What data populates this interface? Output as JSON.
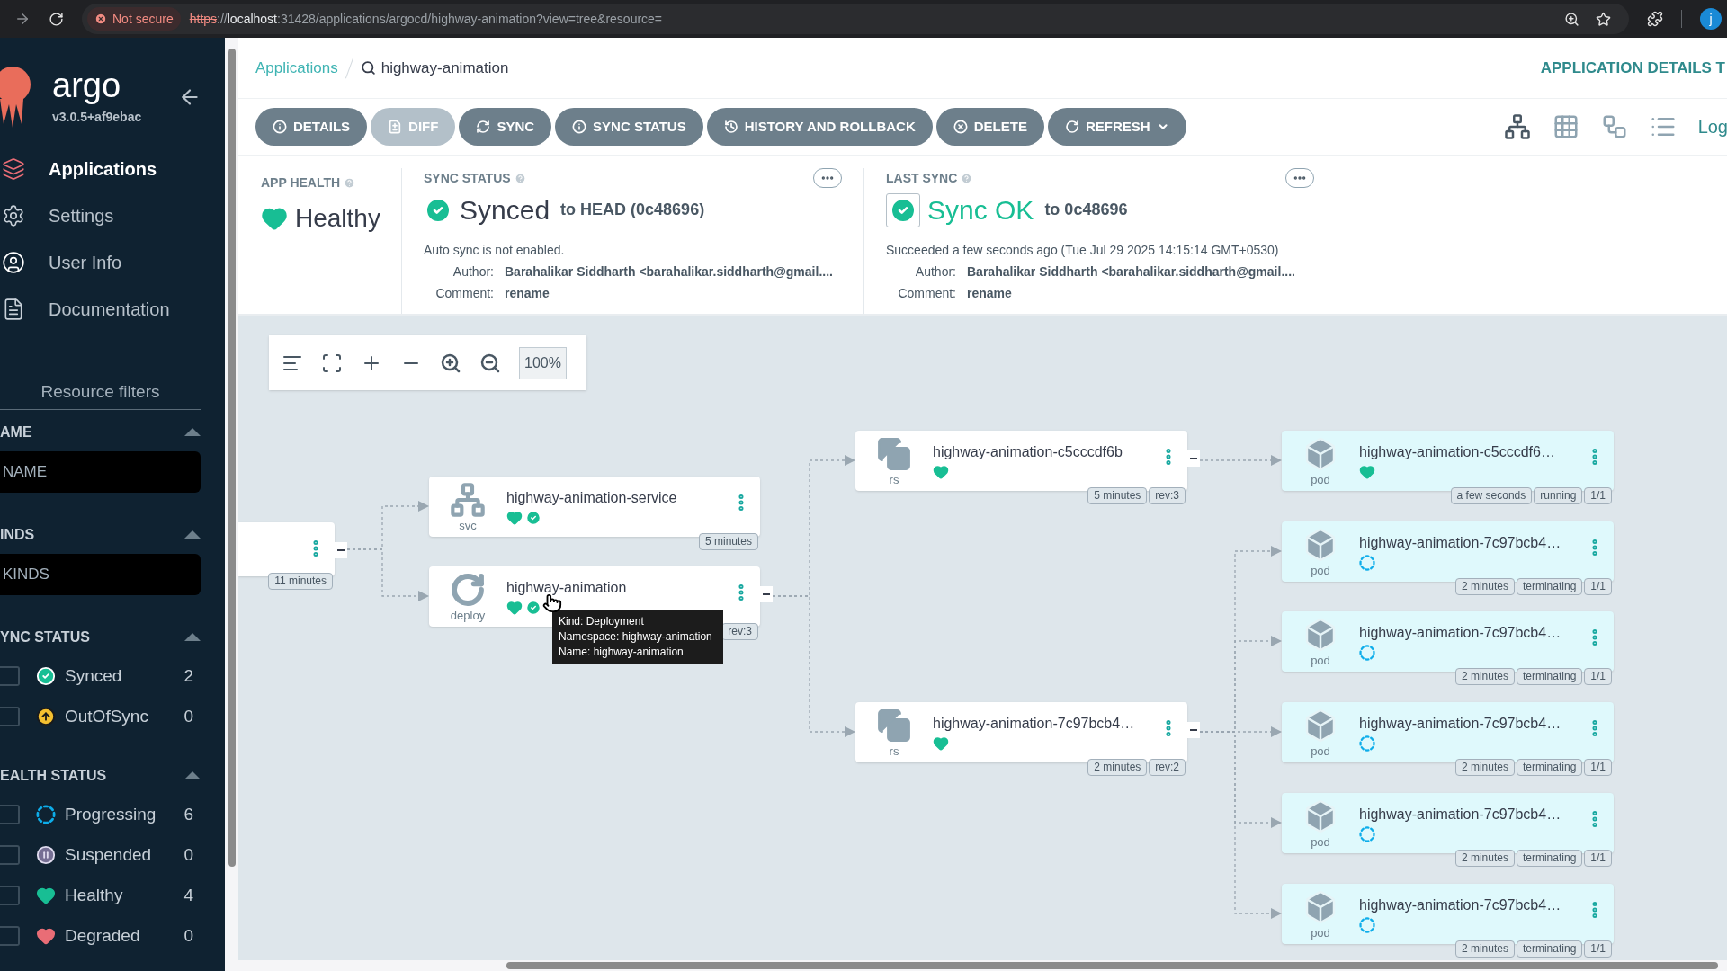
{
  "browser": {
    "security": "Not secure",
    "url_scheme": "https",
    "url_sep": "://",
    "url_host": "localhost",
    "url_path": ":31428/applications/argocd/highway-animation?view=tree&resource=",
    "avatar": "j"
  },
  "sidebar": {
    "logo": "argo",
    "version": "v3.0.5+af9ebac",
    "nav": [
      {
        "label": "Applications",
        "selected": true
      },
      {
        "label": "Settings",
        "selected": false
      },
      {
        "label": "User Info",
        "selected": false
      },
      {
        "label": "Documentation",
        "selected": false
      }
    ],
    "filters_title": "Resource filters",
    "filters": [
      {
        "title": "AME",
        "kind": "field",
        "placeholder": "NAME",
        "expanded": true
      },
      {
        "title": "INDS",
        "kind": "field",
        "placeholder": "KINDS",
        "expanded": true
      },
      {
        "title": "YNC STATUS",
        "kind": "checklist",
        "expanded": true,
        "items": [
          {
            "label": "Synced",
            "count": "2",
            "kind": "synced",
            "checked": false
          },
          {
            "label": "OutOfSync",
            "count": "0",
            "kind": "outofsync",
            "checked": false
          }
        ]
      },
      {
        "title": "EALTH STATUS",
        "kind": "checklist",
        "expanded": true,
        "items": [
          {
            "label": "Progressing",
            "count": "6",
            "kind": "progressing",
            "checked": false
          },
          {
            "label": "Suspended",
            "count": "0",
            "kind": "suspended",
            "checked": false
          },
          {
            "label": "Healthy",
            "count": "4",
            "kind": "healthy",
            "checked": false
          },
          {
            "label": "Degraded",
            "count": "0",
            "kind": "degraded",
            "checked": false
          }
        ]
      }
    ]
  },
  "header": {
    "breadcrumb": "Applications",
    "search_value": "highway-animation",
    "title": "APPLICATION DETAILS T"
  },
  "toolbar": [
    {
      "label": "DETAILS",
      "disabled": false,
      "dropdown": false
    },
    {
      "label": "DIFF",
      "disabled": true,
      "dropdown": false
    },
    {
      "label": "SYNC",
      "disabled": false,
      "dropdown": false
    },
    {
      "label": "SYNC STATUS",
      "disabled": false,
      "dropdown": false
    },
    {
      "label": "HISTORY AND ROLLBACK",
      "disabled": false,
      "dropdown": false
    },
    {
      "label": "DELETE",
      "disabled": false,
      "dropdown": false
    },
    {
      "label": "REFRESH",
      "disabled": false,
      "dropdown": true
    }
  ],
  "views": [
    {
      "kind": "tree",
      "selected": true
    },
    {
      "kind": "grid",
      "selected": false
    },
    {
      "kind": "network",
      "selected": false
    },
    {
      "kind": "list",
      "selected": false
    }
  ],
  "log_link": "Log",
  "app_health": {
    "label": "APP HEALTH",
    "status": "Healthy",
    "kind": "healthy"
  },
  "sync_status": {
    "label": "SYNC STATUS",
    "status": "Synced",
    "target": "to HEAD (0c48696)",
    "note": "Auto sync is not enabled.",
    "fields": [
      {
        "label": "Author:",
        "value": "Barahalikar Siddharth <barahalikar.siddharth@gmail...."
      },
      {
        "label": "Comment:",
        "value": "rename"
      }
    ]
  },
  "last_sync": {
    "label": "LAST SYNC",
    "status": "Sync OK",
    "target": "to 0c48696",
    "note": "Succeeded a few seconds ago (Tue Jul 29 2025 14:15:14 GMT+0530)",
    "fields": [
      {
        "label": "Author:",
        "value": "Barahalikar Siddharth <barahalikar.siddharth@gmail...."
      },
      {
        "label": "Comment:",
        "value": "rename"
      }
    ]
  },
  "graph": {
    "zoom": "100%",
    "nodes": [
      {
        "kind": "app",
        "badges": [
          "11 minutes"
        ]
      },
      {
        "kind": "svc",
        "kind_label": "svc",
        "name": "highway-animation-service",
        "status": [
          {
            "kind": "healthy"
          },
          {
            "kind": "synced"
          }
        ],
        "badges": [
          "5 minutes"
        ]
      },
      {
        "kind": "deploy",
        "kind_label": "deploy",
        "name": "highway-animation",
        "status": [
          {
            "kind": "healthy"
          },
          {
            "kind": "synced"
          }
        ],
        "badges": [
          "rev:3"
        ]
      },
      {
        "kind": "rs",
        "kind_label": "rs",
        "name": "highway-animation-c5cccdf6b",
        "status": [
          {
            "kind": "healthy"
          }
        ],
        "badges": [
          "5 minutes",
          "rev:3"
        ]
      },
      {
        "kind": "rs",
        "kind_label": "rs",
        "name": "highway-animation-7c97bcb4…",
        "status": [
          {
            "kind": "healthy"
          }
        ],
        "badges": [
          "2 minutes",
          "rev:2"
        ]
      },
      {
        "kind": "pod",
        "kind_label": "pod",
        "name": "highway-animation-c5cccdf6…",
        "status": [
          {
            "kind": "healthy"
          }
        ],
        "badges": [
          "a few seconds",
          "running",
          "1/1"
        ]
      },
      {
        "kind": "pod",
        "kind_label": "pod",
        "name": "highway-animation-7c97bcb4…",
        "status": [
          {
            "kind": "progressing"
          }
        ],
        "badges": [
          "2 minutes",
          "terminating",
          "1/1"
        ]
      },
      {
        "kind": "pod",
        "kind_label": "pod",
        "name": "highway-animation-7c97bcb4…",
        "status": [
          {
            "kind": "progressing"
          }
        ],
        "badges": [
          "2 minutes",
          "terminating",
          "1/1"
        ]
      },
      {
        "kind": "pod",
        "kind_label": "pod",
        "name": "highway-animation-7c97bcb4…",
        "status": [
          {
            "kind": "progressing"
          }
        ],
        "badges": [
          "2 minutes",
          "terminating",
          "1/1"
        ]
      },
      {
        "kind": "pod",
        "kind_label": "pod",
        "name": "highway-animation-7c97bcb4…",
        "status": [
          {
            "kind": "progressing"
          }
        ],
        "badges": [
          "2 minutes",
          "terminating",
          "1/1"
        ]
      },
      {
        "kind": "pod",
        "kind_label": "pod",
        "name": "highway-animation-7c97bcb4…",
        "status": [
          {
            "kind": "progressing"
          }
        ],
        "badges": [
          "2 minutes",
          "terminating",
          "1/1"
        ]
      }
    ],
    "tooltip": {
      "lines": [
        "Kind: Deployment",
        "Namespace: highway-animation",
        "Name: highway-animation"
      ]
    }
  }
}
